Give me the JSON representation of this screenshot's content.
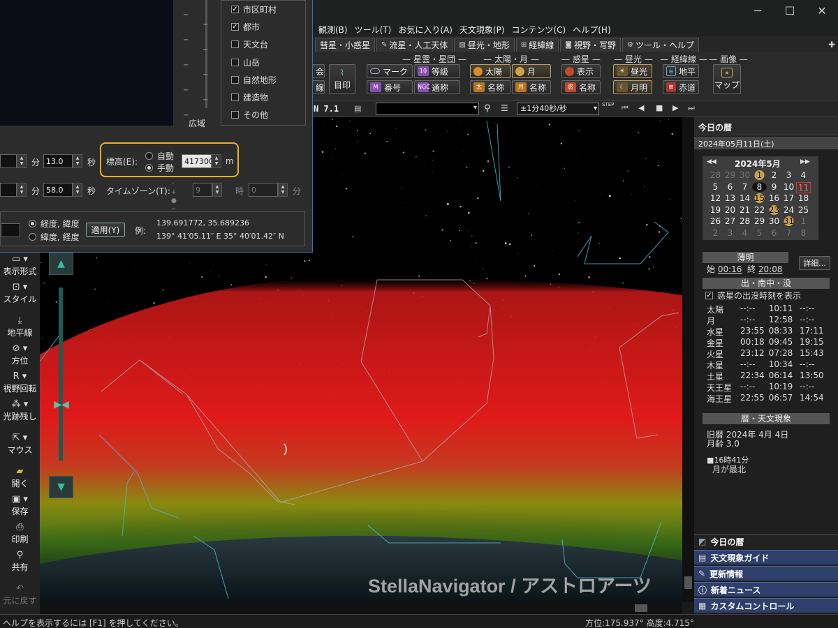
{
  "window": {
    "minimize": "─",
    "maximize": "☐",
    "close": "✕"
  },
  "menu": [
    "観測(B)",
    "ツール(T)",
    "お気に入り(A)",
    "天文現象(P)",
    "コンテンツ(C)",
    "ヘルプ(H)"
  ],
  "tabs": [
    "彗星・小惑星",
    "流星・人工天体",
    "昼光・地形",
    "経緯線",
    "視野・写野",
    "ツール・ヘルプ"
  ],
  "ribbon": {
    "groups": {
      "nebula": "星雲・星団",
      "sunmoon": "太陽・月",
      "planet": "惑星",
      "daylight": "昼光",
      "grid": "経緯線",
      "image": "画像"
    },
    "mark": "マーク",
    "magnitude": "等級",
    "number": "番号",
    "common_name": "通称",
    "sun": "太陽",
    "moon": "月",
    "sun_name": "名称",
    "moon_name": "名称",
    "planet_show": "表示",
    "planet_name": "名称",
    "daylight": "昼光",
    "moonlight": "月明",
    "horizon": "地平",
    "equator": "赤道",
    "map": "マップ",
    "seal": "目印",
    "partial1": "会",
    "partial2": "線"
  },
  "toolbar2": {
    "fov": "N  7.1",
    "time_step": "±1分40秒/秒",
    "step_label": "STEP"
  },
  "dialog": {
    "checks": [
      {
        "label": "市区町村",
        "checked": true
      },
      {
        "label": "都市",
        "checked": true
      },
      {
        "label": "天文台",
        "checked": false
      },
      {
        "label": "山岳",
        "checked": false
      },
      {
        "label": "自然地形",
        "checked": false
      },
      {
        "label": "建造物",
        "checked": false
      },
      {
        "label": "その他",
        "checked": false
      }
    ],
    "wide": "広域",
    "min_label": "分",
    "sec_label": "秒",
    "sec1": "13.0",
    "sec2": "58.0",
    "elev_label": "標高(E):",
    "auto": "自動",
    "manual": "手動",
    "elev_value": "417300",
    "unit_m": "m",
    "tz_label": "タイムゾーン(T):",
    "tz_hour": "9",
    "tz_min": "0",
    "hour": "時",
    "minute": "分",
    "fmt1": "経度, 緯度",
    "fmt2": "緯度, 経度",
    "apply": "適用(Y)",
    "example_label": "例:",
    "example1": "139.691772, 35.689236",
    "example2": "139° 41′05.11″ E 35° 40′01.42″ N"
  },
  "left_panel": [
    "表示形式",
    "スタイル",
    "地平線",
    "方位",
    "視野回転",
    "光跡残し",
    "マウス",
    "開く",
    "保存",
    "印刷",
    "共有",
    "元に戻す"
  ],
  "sky": {
    "watermark": "StellaNavigator / アストロアーツ"
  },
  "right_panel": {
    "title": "今日の暦",
    "date": "2024年05月11日(土)",
    "cal_month": "2024年5月",
    "cal_prev": "◀◀",
    "cal_next": "▶▶",
    "cal_rows": [
      [
        "28",
        "29",
        "30",
        "1",
        "2",
        "3",
        "4"
      ],
      [
        "5",
        "6",
        "7",
        "8",
        "9",
        "10",
        "11"
      ],
      [
        "12",
        "13",
        "14",
        "15",
        "16",
        "17",
        "18"
      ],
      [
        "19",
        "20",
        "21",
        "22",
        "23",
        "24",
        "25"
      ],
      [
        "26",
        "27",
        "28",
        "29",
        "30",
        "31",
        "1"
      ],
      [
        "2",
        "3",
        "4",
        "5",
        "6",
        "7",
        "8"
      ]
    ],
    "twilight": "薄明",
    "tw_start_label": "始",
    "tw_start": "00:16",
    "tw_end_label": "終",
    "tw_end": "20:08",
    "details": "詳細...",
    "rise_title": "出・南中・没",
    "show_planets": "惑星の出没時刻を表示",
    "planets": [
      [
        "太陽",
        "--:--",
        "10:11",
        "--:--"
      ],
      [
        "月",
        "--:--",
        "12:58",
        "--:--"
      ],
      [
        "水星",
        "23:55",
        "08:33",
        "17:11"
      ],
      [
        "金星",
        "00:18",
        "09:45",
        "19:15"
      ],
      [
        "火星",
        "23:12",
        "07:28",
        "15:43"
      ],
      [
        "木星",
        "--:--",
        "10:34",
        "--:--"
      ],
      [
        "土星",
        "22:34",
        "06:14",
        "13:50"
      ],
      [
        "天王星",
        "--:--",
        "10:19",
        "--:--"
      ],
      [
        "海王星",
        "22:55",
        "06:57",
        "14:54"
      ]
    ],
    "events_title": "暦・天文現象",
    "lunar": "旧暦  2024年 4月 4日",
    "moon_age": "月齢 3.0",
    "event1": "■16時41分",
    "event2": "月が最北",
    "links": [
      "今日の暦",
      "天文現象ガイド",
      "更新情報",
      "新着ニュース",
      "カスタムコントロール"
    ]
  },
  "status": {
    "help": "ヘルプを表示するには [F1] を押してください。",
    "coords": "方位:175.937°  高度:4.715°"
  }
}
